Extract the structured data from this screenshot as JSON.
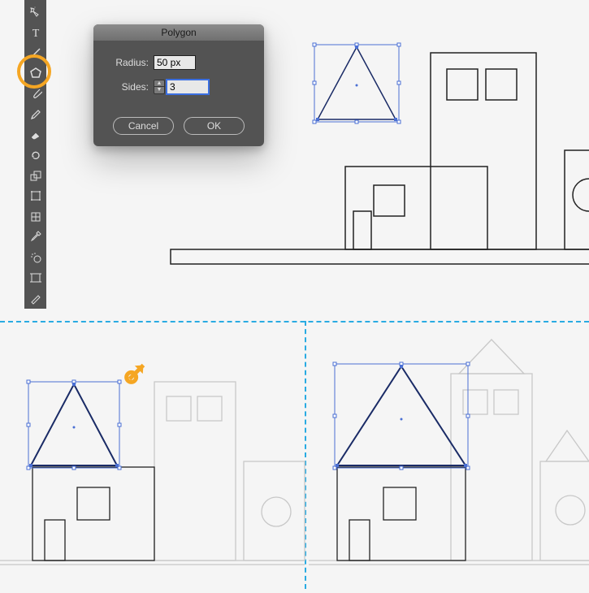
{
  "dialog": {
    "title": "Polygon",
    "radius_label": "Radius:",
    "radius_value": "50 px",
    "sides_label": "Sides:",
    "sides_value": "3",
    "cancel_label": "Cancel",
    "ok_label": "OK"
  },
  "toolbar": {
    "tools": [
      "magic-wand",
      "type",
      "line-segment",
      "polygon",
      "paintbrush",
      "pencil",
      "eraser",
      "rotate",
      "scale",
      "free-transform",
      "mesh",
      "perspective-grid",
      "scissors",
      "artboard",
      "slice"
    ]
  },
  "scenes": {
    "top": {
      "triangle": {
        "selected": true
      },
      "buildings": true
    },
    "bottom_left": {
      "triangle_selected": true,
      "cursor_hint": true
    },
    "bottom_right": {
      "triangle_selected": true
    }
  },
  "colors": {
    "highlight": "#f5a623",
    "guide": "#29abe2",
    "selection": "#4a6fd4"
  }
}
